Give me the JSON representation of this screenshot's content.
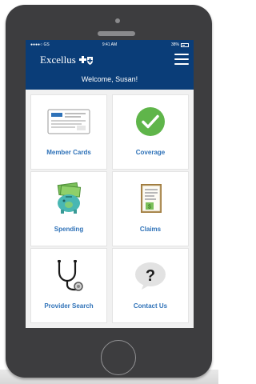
{
  "status_bar": {
    "carrier": "●●●●○ GS",
    "time": "9:41 AM",
    "battery": "38%"
  },
  "header": {
    "brand": "Excellus",
    "welcome": "Welcome, Susan!"
  },
  "tiles": [
    {
      "label": "Member Cards",
      "icon": "member-card-icon"
    },
    {
      "label": "Coverage",
      "icon": "green-checkmark-icon"
    },
    {
      "label": "Spending",
      "icon": "money-piggy-bank-icon"
    },
    {
      "label": "Claims",
      "icon": "claim-document-icon"
    },
    {
      "label": "Provider Search",
      "icon": "stethoscope-icon"
    },
    {
      "label": "Contact Us",
      "icon": "question-bubble-icon"
    }
  ],
  "colors": {
    "header": "#0a3d78",
    "label": "#2f72b8",
    "check": "#5fb54a",
    "phone": "#3d3d3f"
  }
}
